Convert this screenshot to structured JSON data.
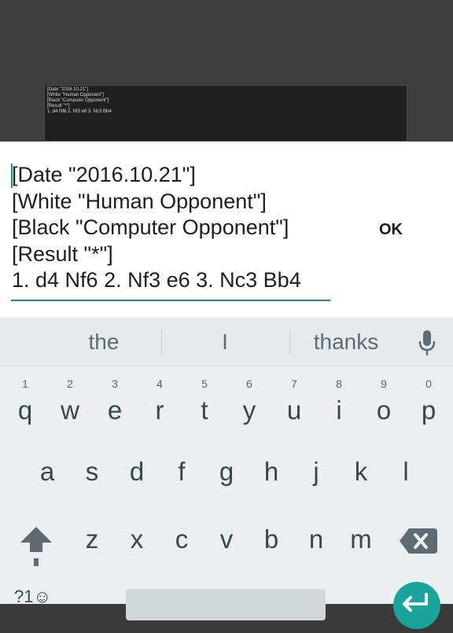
{
  "preview": {
    "lines": [
      "[Date \"2016.10.21\"]",
      "[White \"Human Opponent\"]",
      "[Black \"Computer Opponent\"]",
      "[Result \"*\"]",
      "1. d4 Nf6 2. Nf3 e6 3. Nc3 Bb4"
    ]
  },
  "editor": {
    "lines": [
      "[Date \"2016.10.21\"]",
      "[White \"Human Opponent\"]",
      "[Black \"Computer Opponent\"]",
      "[Result \"*\"]",
      "1. d4 Nf6 2. Nf3 e6 3. Nc3 Bb4"
    ],
    "ok_label": "OK",
    "accent_color": "#1a8a8a"
  },
  "keyboard": {
    "suggestions": [
      "the",
      "I",
      "thanks"
    ],
    "mic_icon": "microphone-icon",
    "row1": [
      {
        "hint": "1",
        "key": "q"
      },
      {
        "hint": "2",
        "key": "w"
      },
      {
        "hint": "3",
        "key": "e"
      },
      {
        "hint": "4",
        "key": "r"
      },
      {
        "hint": "5",
        "key": "t"
      },
      {
        "hint": "6",
        "key": "y"
      },
      {
        "hint": "7",
        "key": "u"
      },
      {
        "hint": "8",
        "key": "i"
      },
      {
        "hint": "9",
        "key": "o"
      },
      {
        "hint": "0",
        "key": "p"
      }
    ],
    "row2": [
      "a",
      "s",
      "d",
      "f",
      "g",
      "h",
      "j",
      "k",
      "l"
    ],
    "row3": [
      "z",
      "x",
      "c",
      "v",
      "b",
      "n",
      "m"
    ],
    "symbols_label": "?1☺",
    "shift_icon": "shift-arrow-icon",
    "backspace_icon": "backspace-icon",
    "enter_icon": "enter-arrow-icon",
    "enter_color": "#1aa39a"
  }
}
